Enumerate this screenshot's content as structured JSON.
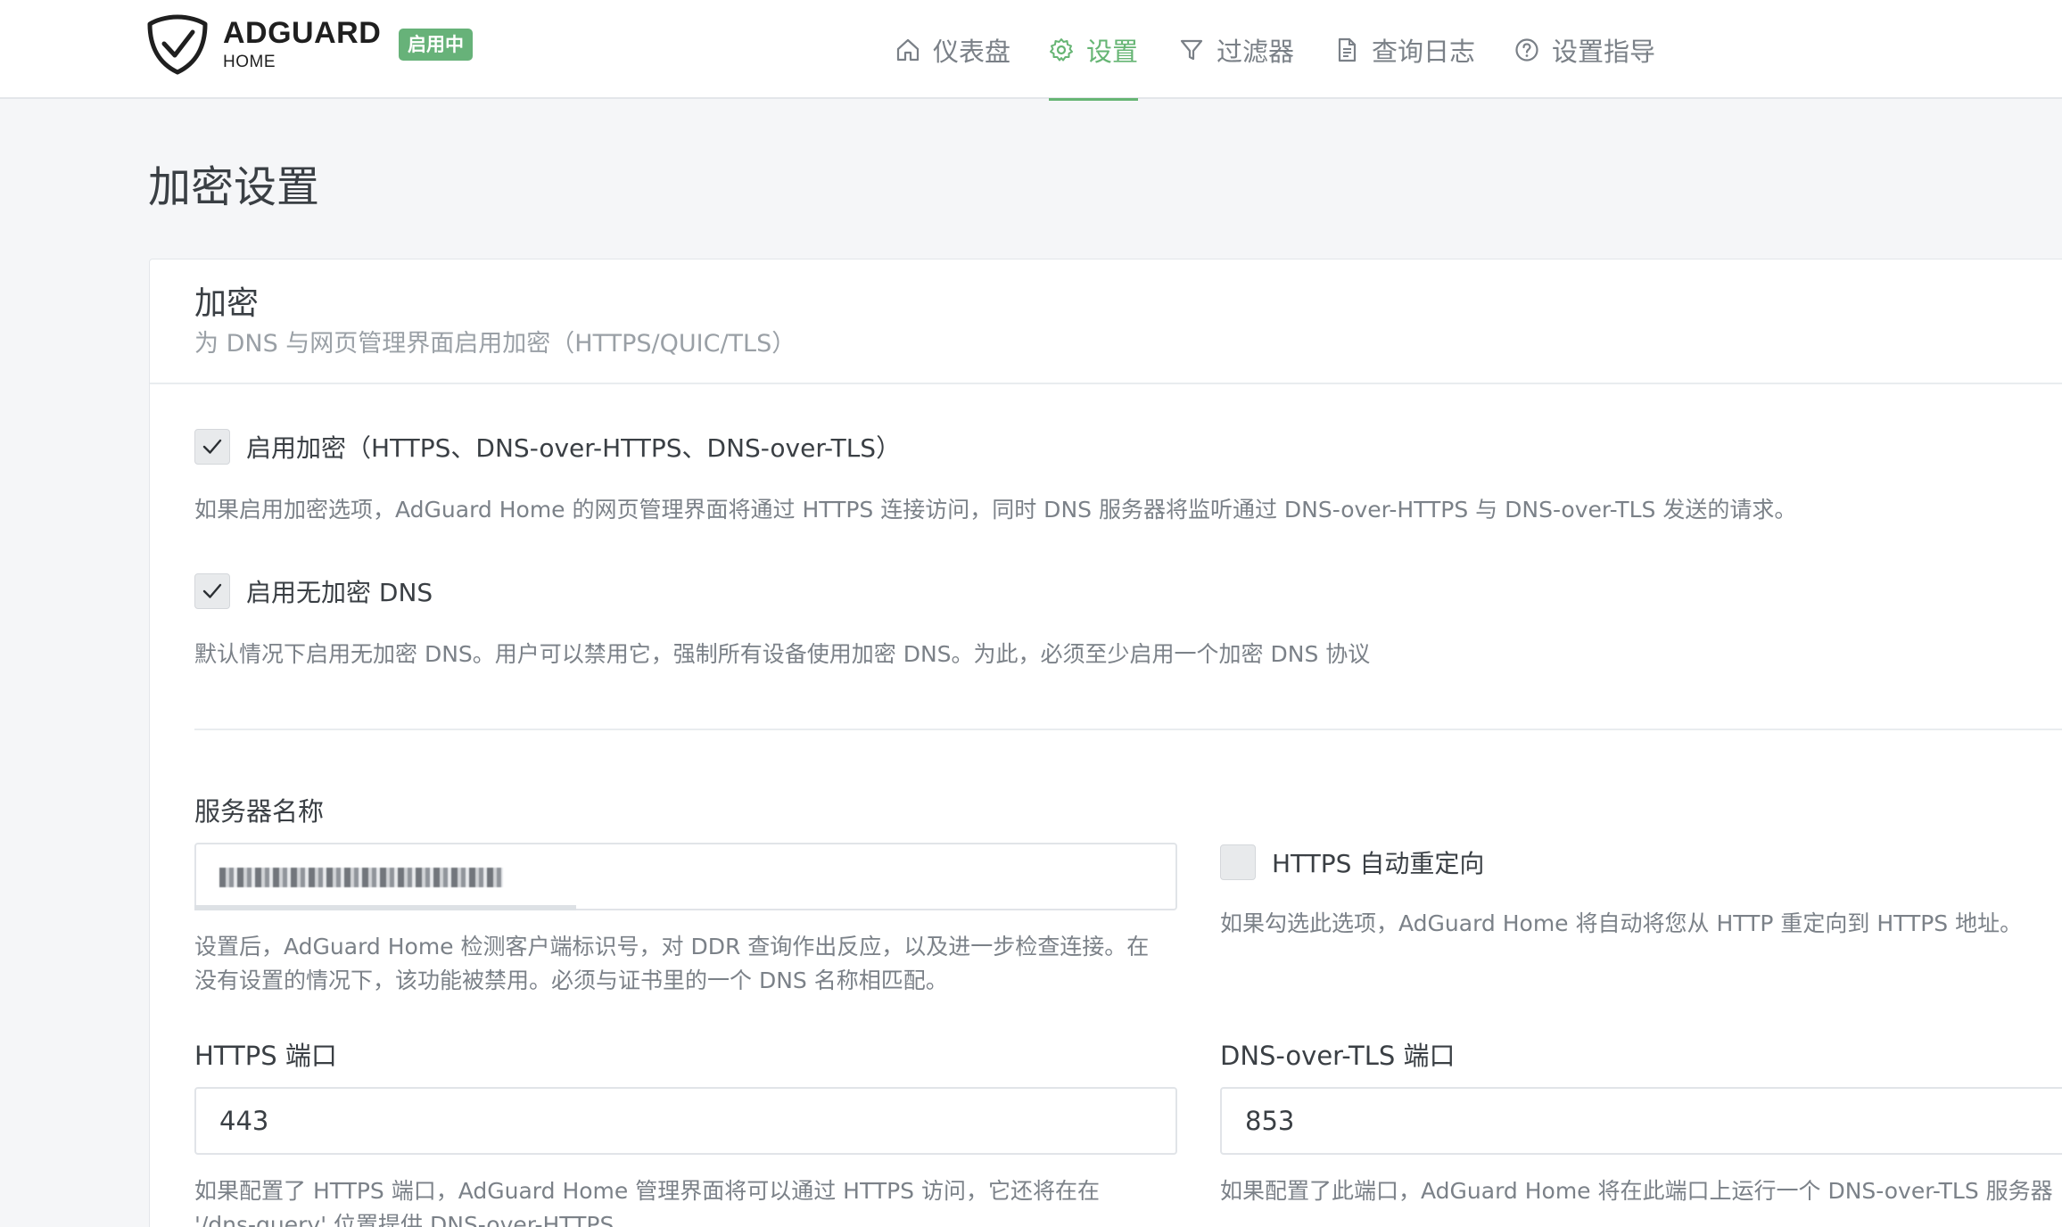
{
  "header": {
    "brand_name": "ADGUARD",
    "brand_sub": "HOME",
    "status_badge": "启用中",
    "nav": {
      "dashboard": "仪表盘",
      "settings": "设置",
      "filters": "过滤器",
      "query_log": "查询日志",
      "setup_guide": "设置指导"
    },
    "accent_color": "#66b574"
  },
  "page": {
    "title": "加密设置"
  },
  "card": {
    "title": "加密",
    "subtitle": "为 DNS 与网页管理界面启用加密（HTTPS/QUIC/TLS）",
    "enable_encryption": {
      "label": "启用加密（HTTPS、DNS-over-HTTPS、DNS-over-TLS）",
      "checked": true,
      "help": "如果启用加密选项，AdGuard Home 的网页管理界面将通过 HTTPS 连接访问，同时 DNS 服务器将监听通过 DNS-over-HTTPS 与 DNS-over-TLS 发送的请求。"
    },
    "enable_plain_dns": {
      "label": "启用无加密 DNS",
      "checked": true,
      "help": "默认情况下启用无加密 DNS。用户可以禁用它，强制所有设备使用加密 DNS。为此，必须至少启用一个加密 DNS 协议"
    },
    "server_name": {
      "label": "服务器名称",
      "help_line1": "设置后，AdGuard Home 检测客户端标识号，对 DDR 查询作出反应，以及进一步检查连接。在",
      "help_line2": "没有设置的情况下，该功能被禁用。必须与证书里的一个 DNS 名称相匹配。"
    },
    "https_redirect": {
      "label": "HTTPS 自动重定向",
      "checked": false,
      "help": "如果勾选此选项，AdGuard Home 将自动将您从 HTTP 重定向到 HTTPS 地址。"
    },
    "https_port": {
      "label": "HTTPS 端口",
      "value": "443",
      "help_line1": "如果配置了 HTTPS 端口，AdGuard Home 管理界面将可以通过 HTTPS 访问，它还将在在",
      "help_line2": "'/dns-query' 位置提供 DNS-over-HTTPS"
    },
    "dot_port": {
      "label": "DNS-over-TLS 端口",
      "value": "853",
      "help": "如果配置了此端口，AdGuard Home 将在此端口上运行一个 DNS-over-TLS 服务器"
    }
  }
}
